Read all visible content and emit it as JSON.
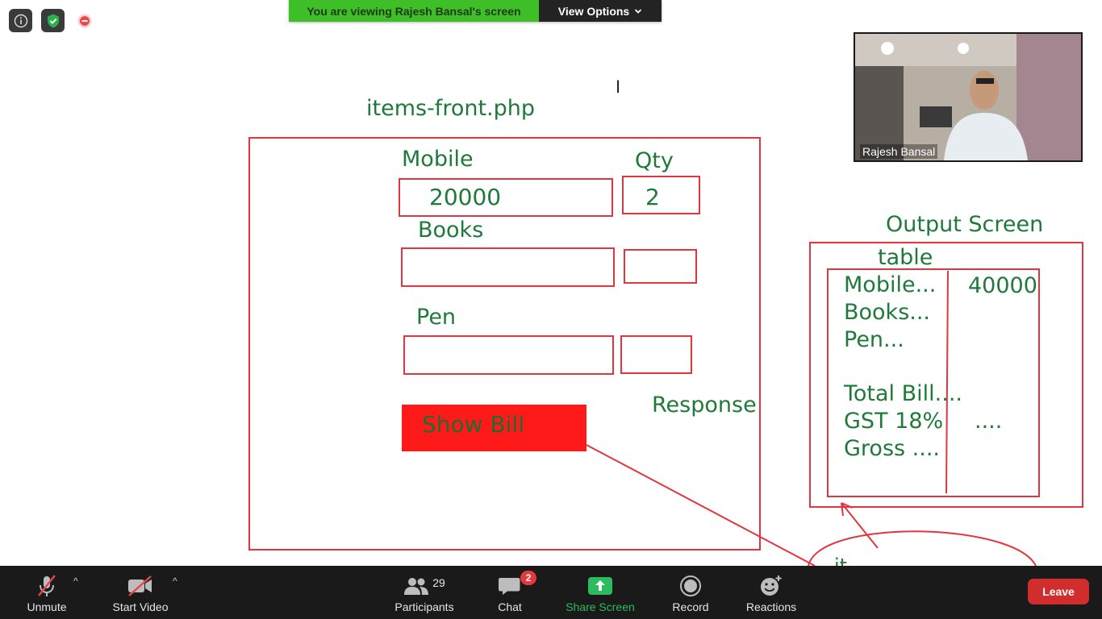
{
  "top_icons": {
    "info": "info-icon",
    "security": "shield-check-icon",
    "recording": "recording-indicator-icon"
  },
  "banner": {
    "viewing_text": "You are viewing Rajesh Bansal's screen",
    "view_options_label": "View Options",
    "view_options_caret": "⌄"
  },
  "whiteboard": {
    "file_title": "items-front.php",
    "mobile_label": "Mobile",
    "qty_label": "Qty",
    "mobile_value": "20000",
    "qty_value": "2",
    "books_label": "Books",
    "pen_label": "Pen",
    "show_bill_label": "Show Bill",
    "response_label": "Response",
    "output_title": "Output Screen",
    "table_label": "table",
    "output_rows": [
      "Mobile...",
      "Books...",
      "Pen...",
      "",
      "Total Bill....",
      "GST 18%",
      "Gross ...."
    ],
    "output_values": [
      "40000",
      "",
      "",
      "",
      "",
      "....",
      ""
    ],
    "bottom_partial_text": "it"
  },
  "video": {
    "participant_name": "Rajesh Bansal"
  },
  "toolbar": {
    "unmute_label": "Unmute",
    "start_video_label": "Start Video",
    "participants_label": "Participants",
    "participants_count": "29",
    "chat_label": "Chat",
    "chat_badge": "2",
    "share_screen_label": "Share Screen",
    "record_label": "Record",
    "reactions_label": "Reactions",
    "leave_label": "Leave",
    "caret": "^"
  },
  "colors": {
    "accent_green": "#3fbf27",
    "share_green": "#2dbb5f",
    "leave_red": "#d22d2d",
    "ink_green": "#1f7a3a",
    "ink_red": "#e3353f",
    "toolbar_bg": "#1a1a1a"
  }
}
